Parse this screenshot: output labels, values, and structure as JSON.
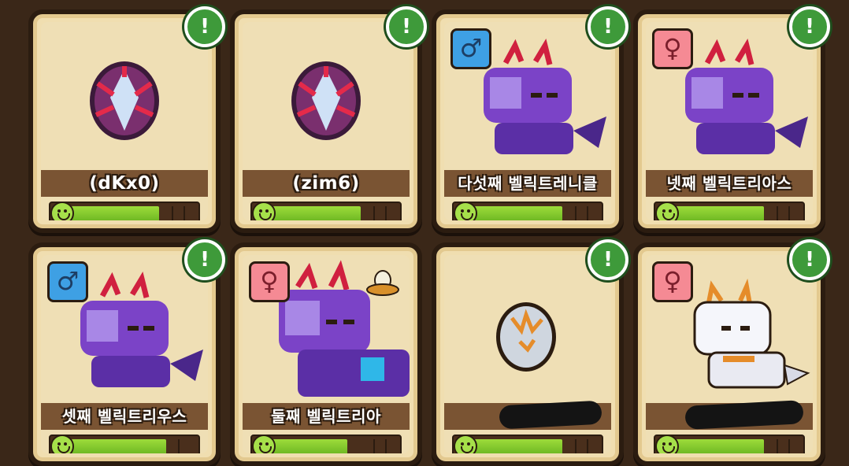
{
  "grid": {
    "cards": [
      {
        "name": "(dKx0)",
        "gender": "",
        "art": "egg-dragon-icon",
        "progress": 0.72,
        "alert": "!",
        "hidden_name": false
      },
      {
        "name": "(zim6)",
        "gender": "",
        "art": "egg-dragon-icon",
        "progress": 0.72,
        "alert": "!",
        "hidden_name": false
      },
      {
        "name": "다섯째 벨릭트레니클",
        "gender": "♂",
        "art": "purple-dragon-icon",
        "progress": 0.72,
        "alert": "!",
        "hidden_name": false
      },
      {
        "name": "넷째 벨릭트리아스",
        "gender": "♀",
        "art": "purple-dragon-icon",
        "progress": 0.72,
        "alert": "!",
        "hidden_name": false
      },
      {
        "name": "셋째 벨릭트리우스",
        "gender": "♂",
        "art": "purple-dragon-icon",
        "progress": 0.77,
        "alert": "!",
        "hidden_name": false
      },
      {
        "name": "둘째 벨릭트리아",
        "gender": "♀",
        "art": "large-purple-dragon-icon",
        "progress": 0.62,
        "alert": "",
        "hidden_name": false,
        "extra": "nest-egg-icon"
      },
      {
        "name": "",
        "gender": "",
        "art": "white-egg-icon",
        "progress": 0.72,
        "alert": "!",
        "hidden_name": true
      },
      {
        "name": "",
        "gender": "♀",
        "art": "white-dragon-icon",
        "progress": 0.72,
        "alert": "!",
        "hidden_name": true
      }
    ]
  },
  "colors": {
    "background": "#3a2718",
    "card": "#f0deb0",
    "bar": "#7fc82d",
    "alert": "#3e9a3a",
    "male": "#3ea0e4",
    "female": "#f58a94"
  }
}
